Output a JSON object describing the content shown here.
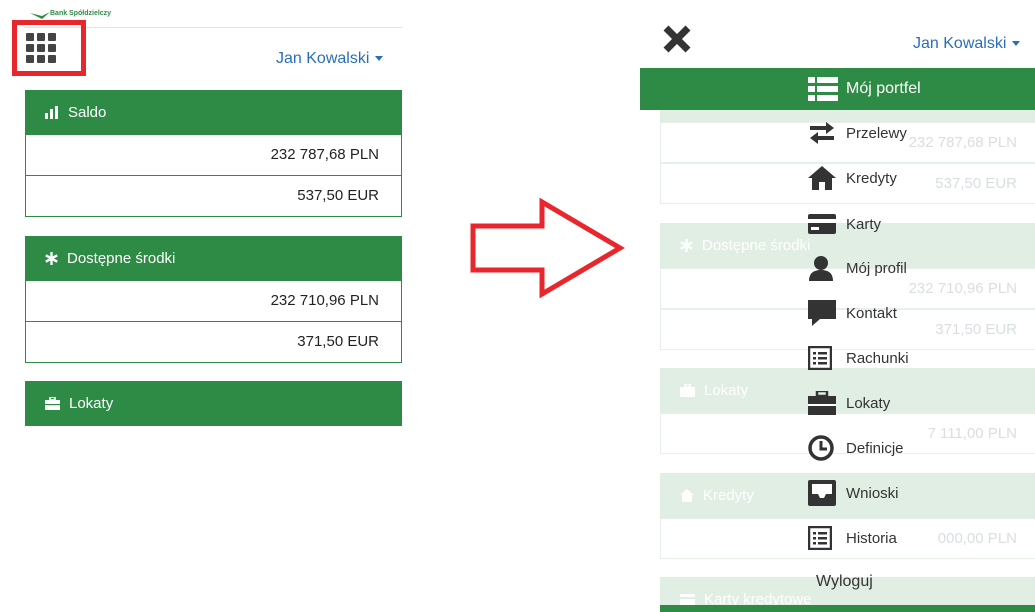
{
  "brand": {
    "logo_text": "Bank Spółdzielczy",
    "accent_color": "#2e8b46",
    "highlight_color": "#e8262b"
  },
  "header": {
    "user_name": "Jan Kowalski"
  },
  "left": {
    "panels": [
      {
        "title": "Saldo",
        "icon": "bar-chart-icon",
        "rows": [
          "232 787,68 PLN",
          "537,50 EUR"
        ]
      },
      {
        "title": "Dostępne środki",
        "icon": "asterisk-icon",
        "rows": [
          "232 710,96 PLN",
          "371,50 EUR"
        ]
      },
      {
        "title": "Lokaty",
        "icon": "briefcase-icon",
        "rows": []
      }
    ]
  },
  "right": {
    "background": {
      "rows_top": [
        "232 787,68 PLN",
        "537,50 EUR"
      ],
      "panel_dostepne": "Dostępne środki",
      "rows_dostepne": [
        "232 710,96 PLN",
        "371,50 EUR"
      ],
      "panel_lokaty": "Lokaty",
      "row_lokaty": "7 111,00 PLN",
      "panel_kredyty": "Kredyty",
      "row_kredyty": "000,00 PLN",
      "panel_karty": "Karty kredytowe"
    },
    "menu": [
      {
        "label": "Mój portfel",
        "icon": "list-icon",
        "active": true
      },
      {
        "label": "Przelewy",
        "icon": "transfer-icon"
      },
      {
        "label": "Kredyty",
        "icon": "home-icon"
      },
      {
        "label": "Karty",
        "icon": "card-icon"
      },
      {
        "label": "Mój profil",
        "icon": "user-icon"
      },
      {
        "label": "Kontakt",
        "icon": "comment-icon"
      },
      {
        "label": "Rachunki",
        "icon": "list-alt-icon"
      },
      {
        "label": "Lokaty",
        "icon": "briefcase-icon"
      },
      {
        "label": "Definicje",
        "icon": "clock-icon"
      },
      {
        "label": "Wnioski",
        "icon": "inbox-icon"
      },
      {
        "label": "Historia",
        "icon": "list-alt-icon"
      }
    ],
    "logout": "Wyloguj"
  }
}
